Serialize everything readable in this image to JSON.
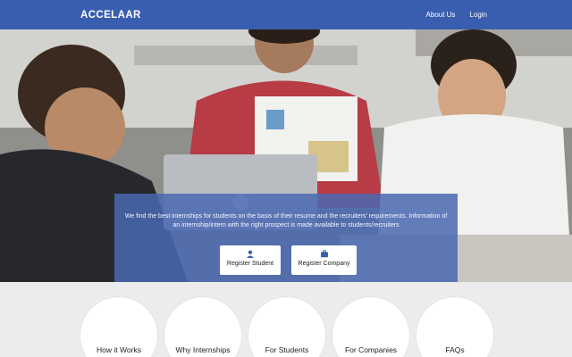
{
  "header": {
    "brand": "ACCELAAR",
    "nav": {
      "about": "About Us",
      "login": "Login"
    }
  },
  "hero": {
    "tagline": "We find the best internships for students on the basis of their resume and the recruiters' requirements. Information of an internship/intern with the right prospect is made available to students/recruiters",
    "buttons": {
      "register_student": "Register Student",
      "register_company": "Register Company"
    },
    "overlay_color": "#3a5eaf"
  },
  "features": [
    {
      "label": "How it Works"
    },
    {
      "label": "Why Internships"
    },
    {
      "label": "For Students"
    },
    {
      "label": "For Companies"
    },
    {
      "label": "FAQs"
    }
  ],
  "colors": {
    "brand_blue": "#3a5eaf",
    "page_bg": "#ececec"
  },
  "icons": {
    "student": "user-icon",
    "company": "briefcase-icon"
  }
}
